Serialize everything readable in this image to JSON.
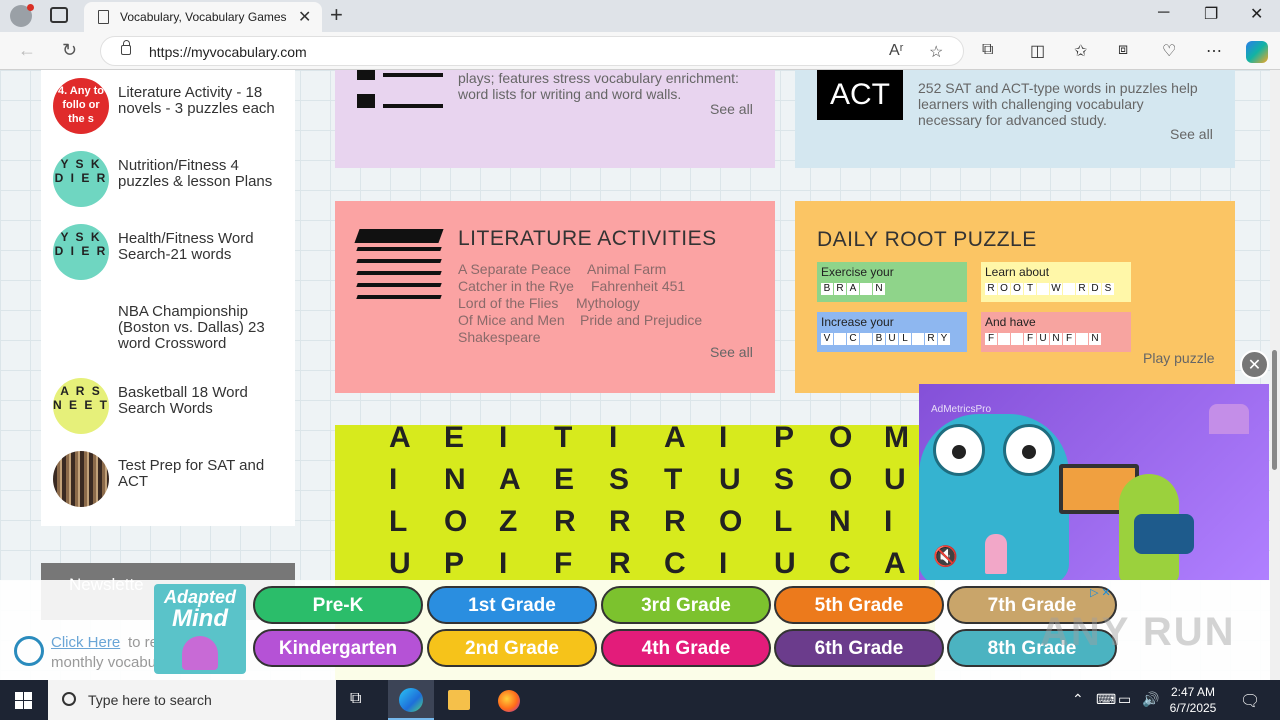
{
  "browser": {
    "tab_title": "Vocabulary, Vocabulary Games - ",
    "url": "https://myvocabulary.com",
    "read_aloud": "Aʳ"
  },
  "sidebar": {
    "items": [
      {
        "label": "Literature Activity - 18 novels - 3 puzzles each",
        "thumb": "4. Any to follo or the s"
      },
      {
        "label": "Nutrition/Fitness 4 puzzles & lesson Plans",
        "thumb": "Y S K D I E R"
      },
      {
        "label": "Health/Fitness Word Search-21 words",
        "thumb": "Y S K D I E R"
      },
      {
        "label": "NBA Championship (Boston vs. Dallas) 23 word Crossword",
        "thumb": ""
      },
      {
        "label": "Basketball 18 Word Search Words",
        "thumb": "A R S N E E T"
      },
      {
        "label": "Test Prep for SAT and ACT",
        "thumb": ""
      }
    ],
    "newsletter": "Newslette"
  },
  "cards": {
    "top_left": {
      "desc_1": "plays; features stress vocabulary enrichment:",
      "desc_2": "word lists for writing and word walls.",
      "see_all": "See all"
    },
    "top_right": {
      "badge": "ACT",
      "desc_1": "252 SAT and ACT-type words in puzzles help",
      "desc_2": "learners with challenging vocabulary",
      "desc_3": "necessary for advanced study.",
      "see_all": "See all"
    },
    "literature": {
      "title": "LITERATURE ACTIVITIES",
      "links": [
        "A Separate Peace",
        "Animal Farm",
        "Catcher in the Rye",
        "Fahrenheit 451",
        "Lord of the Flies",
        "Mythology",
        "Of Mice and Men",
        "Pride and Prejudice",
        "Shakespeare"
      ],
      "see_all": "See all"
    },
    "root_puzzle": {
      "title": "DAILY ROOT PUZZLE",
      "boxes": [
        {
          "title": "Exercise your",
          "letters": [
            "B",
            "R",
            "A",
            "",
            "N"
          ],
          "color": "#8fd48a"
        },
        {
          "title": "Learn about",
          "letters": [
            "R",
            "O",
            "O",
            "T",
            "",
            "W",
            "",
            "R",
            "D",
            "S"
          ],
          "color": "#fff7a8"
        },
        {
          "title": "Increase your",
          "letters": [
            "V",
            "",
            "C",
            "",
            "B",
            "U",
            "L",
            "",
            "R",
            "Y"
          ],
          "color": "#8eb7f0"
        },
        {
          "title": "And have",
          "letters": [
            "F",
            "",
            "",
            "F",
            "U",
            "N",
            "F",
            "",
            "N"
          ],
          "color": "#f7a4a0"
        }
      ],
      "play": "Play puzzle"
    }
  },
  "wordsearch": {
    "rows": [
      [
        "A",
        "E",
        "I",
        "T",
        "I",
        "A",
        "I",
        "P",
        "O",
        "M"
      ],
      [
        "I",
        "N",
        "A",
        "E",
        "S",
        "T",
        "U",
        "S",
        "O",
        "U"
      ],
      [
        "L",
        "O",
        "Z",
        "R",
        "R",
        "R",
        "O",
        "L",
        "N",
        "I"
      ],
      [
        "U",
        "P",
        "I",
        "F",
        "R",
        "C",
        "I",
        "U",
        "C",
        "A"
      ]
    ]
  },
  "video_ad": {
    "brand": "AdMetricsPro",
    "close": "✕"
  },
  "grade_ad": {
    "logo_line1": "Adapted",
    "logo_line2": "Mind",
    "click_link": "Click Here",
    "click_rest": "to re",
    "click_line2": "monthly vocabu",
    "grades": [
      {
        "label": "Pre-K",
        "color": "#2bbd6a"
      },
      {
        "label": "1st Grade",
        "color": "#2a8ee0"
      },
      {
        "label": "3rd Grade",
        "color": "#7cc22e"
      },
      {
        "label": "5th Grade",
        "color": "#ec7a1c"
      },
      {
        "label": "7th Grade",
        "color": "#c9a56a"
      },
      {
        "label": "Kindergarten",
        "color": "#b552d6"
      },
      {
        "label": "2nd Grade",
        "color": "#f6c31a"
      },
      {
        "label": "4th Grade",
        "color": "#e31c7a"
      },
      {
        "label": "6th Grade",
        "color": "#6b3c8c"
      },
      {
        "label": "8th Grade",
        "color": "#4bb3c1"
      }
    ],
    "adchoice": "▷ ✕",
    "watermark": "ANY RUN"
  },
  "taskbar": {
    "search_placeholder": "Type here to search",
    "time": "2:47 AM",
    "date": "6/7/2025"
  }
}
